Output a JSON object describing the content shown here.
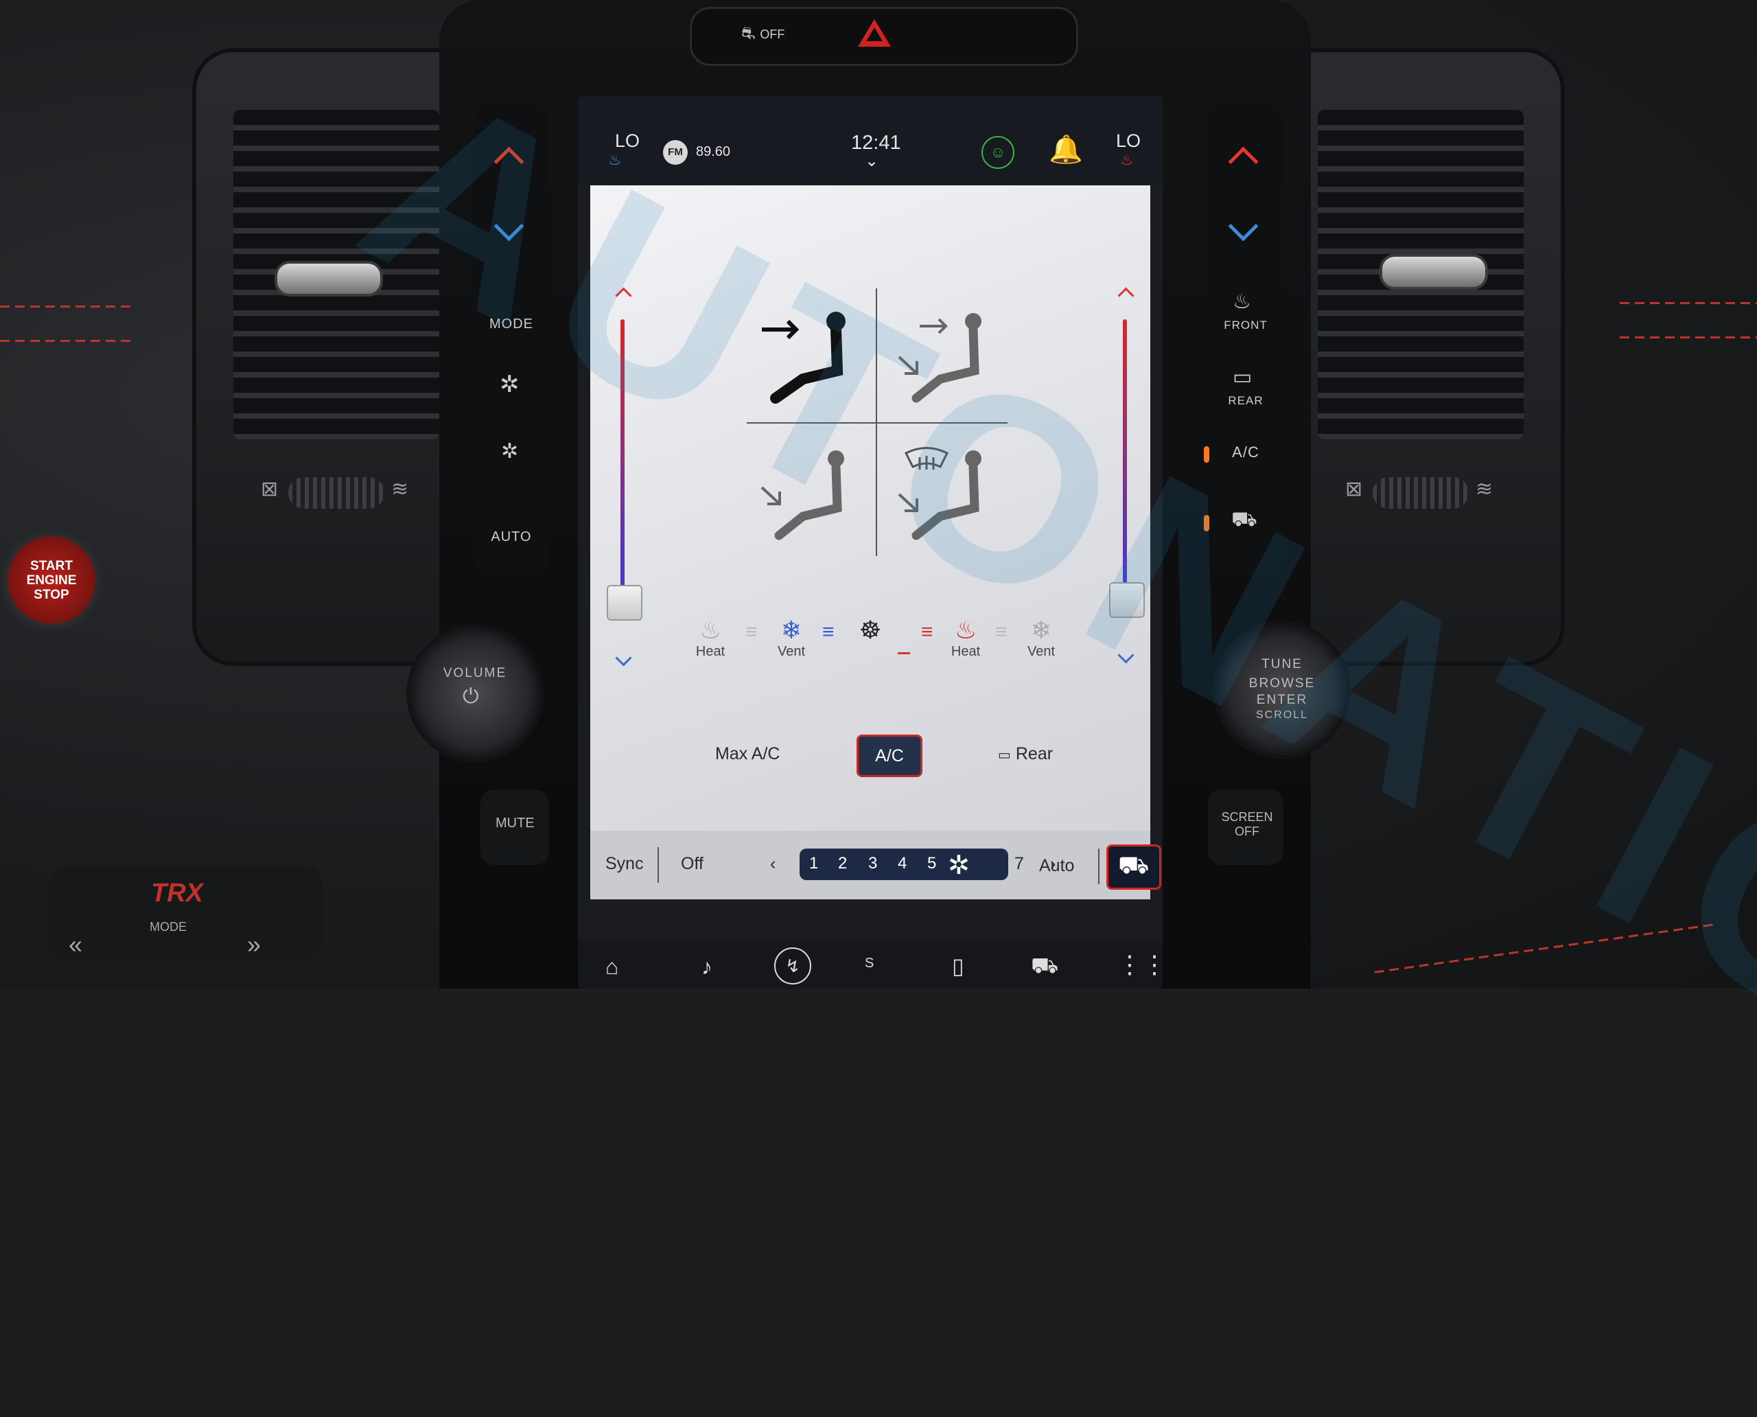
{
  "top_strip": {
    "traction_label": "OFF"
  },
  "status_bar": {
    "left_temp": "LO",
    "radio_band": "FM",
    "radio_freq": "89.60",
    "clock": "12:41",
    "right_temp": "LO"
  },
  "left_controls": {
    "mode_label": "MODE",
    "auto_label": "AUTO",
    "volume_label": "VOLUME",
    "mute_label": "MUTE"
  },
  "right_controls": {
    "front_label": "FRONT",
    "rear_label": "REAR",
    "ac_label": "A/C",
    "tune_label": "TUNE",
    "browse_label": "BROWSE",
    "enter_label": "ENTER",
    "scroll_label": "SCROLL",
    "screen_off_label": "SCREEN OFF"
  },
  "start_button": {
    "line1": "START",
    "line2": "ENGINE",
    "line3": "STOP"
  },
  "drive_mode": {
    "badge": "TRX",
    "label": "MODE"
  },
  "seat_controls": {
    "driver_heat": "Heat",
    "driver_vent": "Vent",
    "passenger_heat": "Heat",
    "passenger_vent": "Vent"
  },
  "climate_buttons": {
    "max_ac": "Max A/C",
    "ac": "A/C",
    "rear": "Rear"
  },
  "fan_bar": {
    "sync": "Sync",
    "off": "Off",
    "speeds": [
      "1",
      "2",
      "3",
      "4",
      "5",
      "7"
    ],
    "active_speed": 6,
    "auto": "Auto"
  },
  "nav_bar": {
    "center_label": "S"
  },
  "watermark": "AUTONATION",
  "colors": {
    "accent_red": "#c62a24",
    "accent_blue": "#1e2a45",
    "heat_red": "#e4392e",
    "cool_blue": "#3e8bd8"
  }
}
